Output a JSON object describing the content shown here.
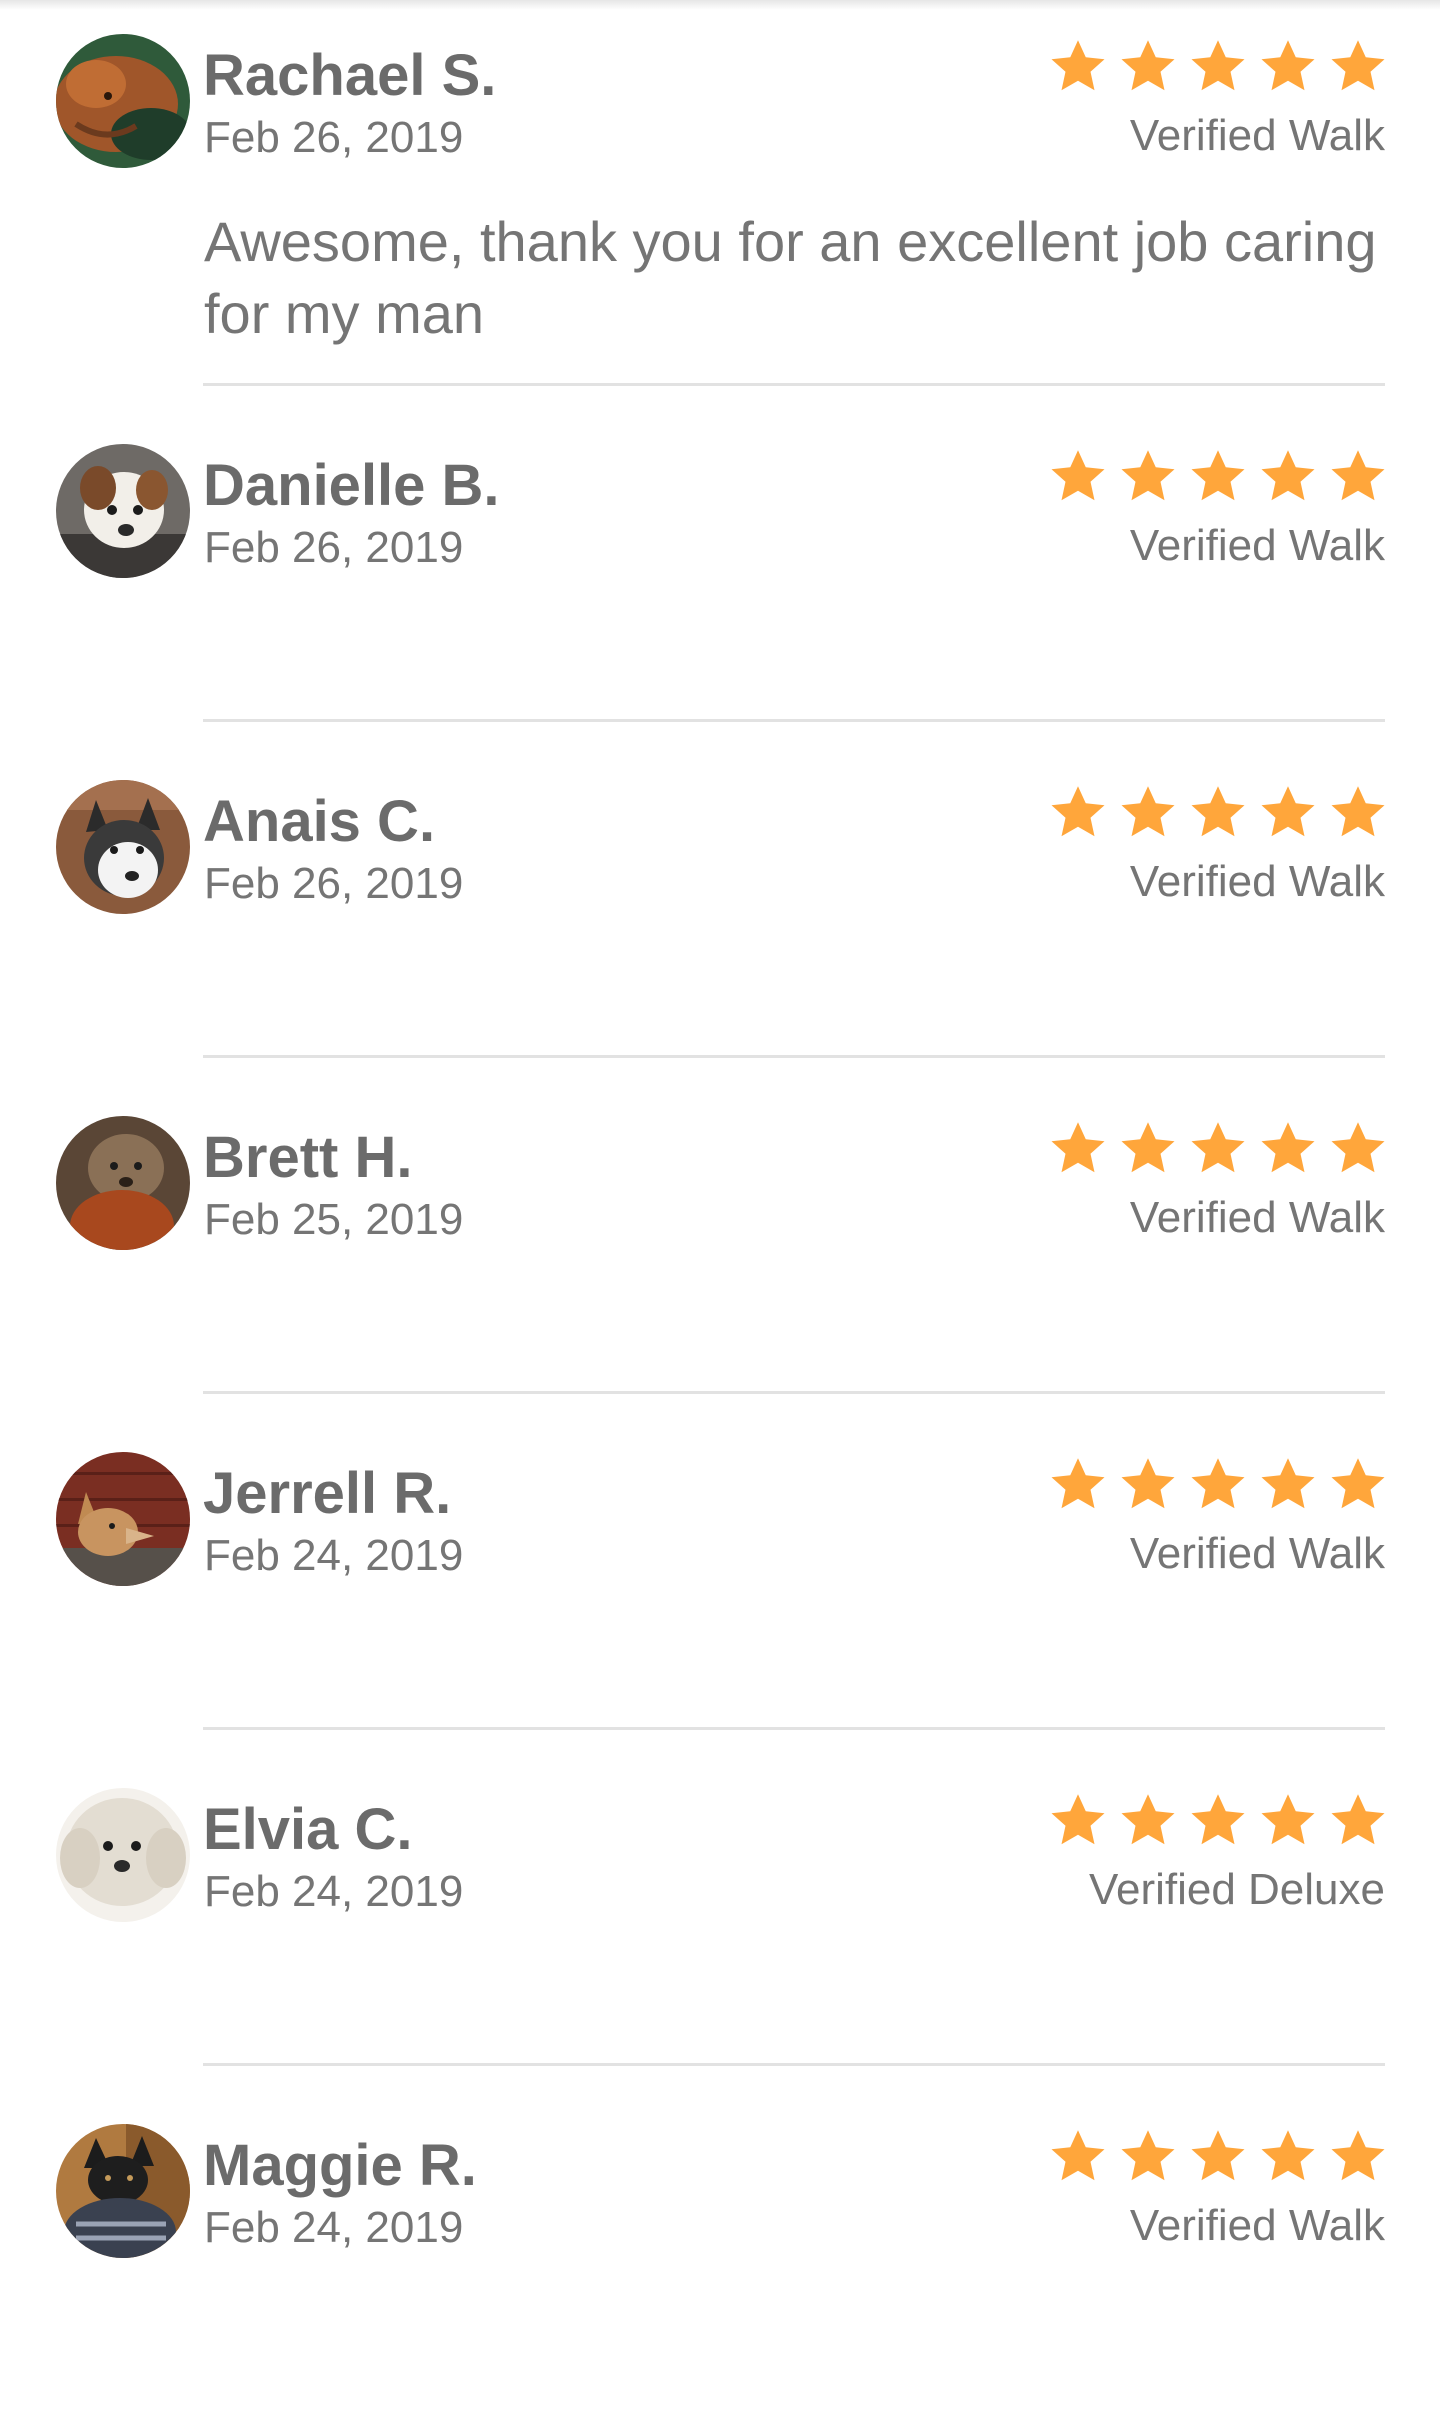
{
  "colors": {
    "star": "#FFA63B",
    "name": "#6b6b6b",
    "secondary_text": "#757575",
    "divider": "#e2e2e2"
  },
  "reviews": [
    {
      "name": "Rachael S.",
      "date": "Feb 26, 2019",
      "rating": 5,
      "verification": "Verified Walk",
      "comment": "Awesome, thank you for an excellent job caring for my man",
      "avatar_icon": "dog-avatar-brown"
    },
    {
      "name": "Danielle B.",
      "date": "Feb 26, 2019",
      "rating": 5,
      "verification": "Verified Walk",
      "comment": "",
      "avatar_icon": "dog-avatar-white-brown"
    },
    {
      "name": "Anais C.",
      "date": "Feb 26, 2019",
      "rating": 5,
      "verification": "Verified Walk",
      "comment": "",
      "avatar_icon": "dog-avatar-husky"
    },
    {
      "name": "Brett H.",
      "date": "Feb 25, 2019",
      "rating": 5,
      "verification": "Verified Walk",
      "comment": "",
      "avatar_icon": "dog-avatar-terrier"
    },
    {
      "name": "Jerrell R.",
      "date": "Feb 24, 2019",
      "rating": 5,
      "verification": "Verified Walk",
      "comment": "",
      "avatar_icon": "dog-avatar-shiba"
    },
    {
      "name": "Elvia C.",
      "date": "Feb 24, 2019",
      "rating": 5,
      "verification": "Verified Deluxe",
      "comment": "",
      "avatar_icon": "dog-avatar-doodle"
    },
    {
      "name": "Maggie R.",
      "date": "Feb 24, 2019",
      "rating": 5,
      "verification": "Verified Walk",
      "comment": "",
      "avatar_icon": "dog-avatar-black-tan"
    }
  ]
}
